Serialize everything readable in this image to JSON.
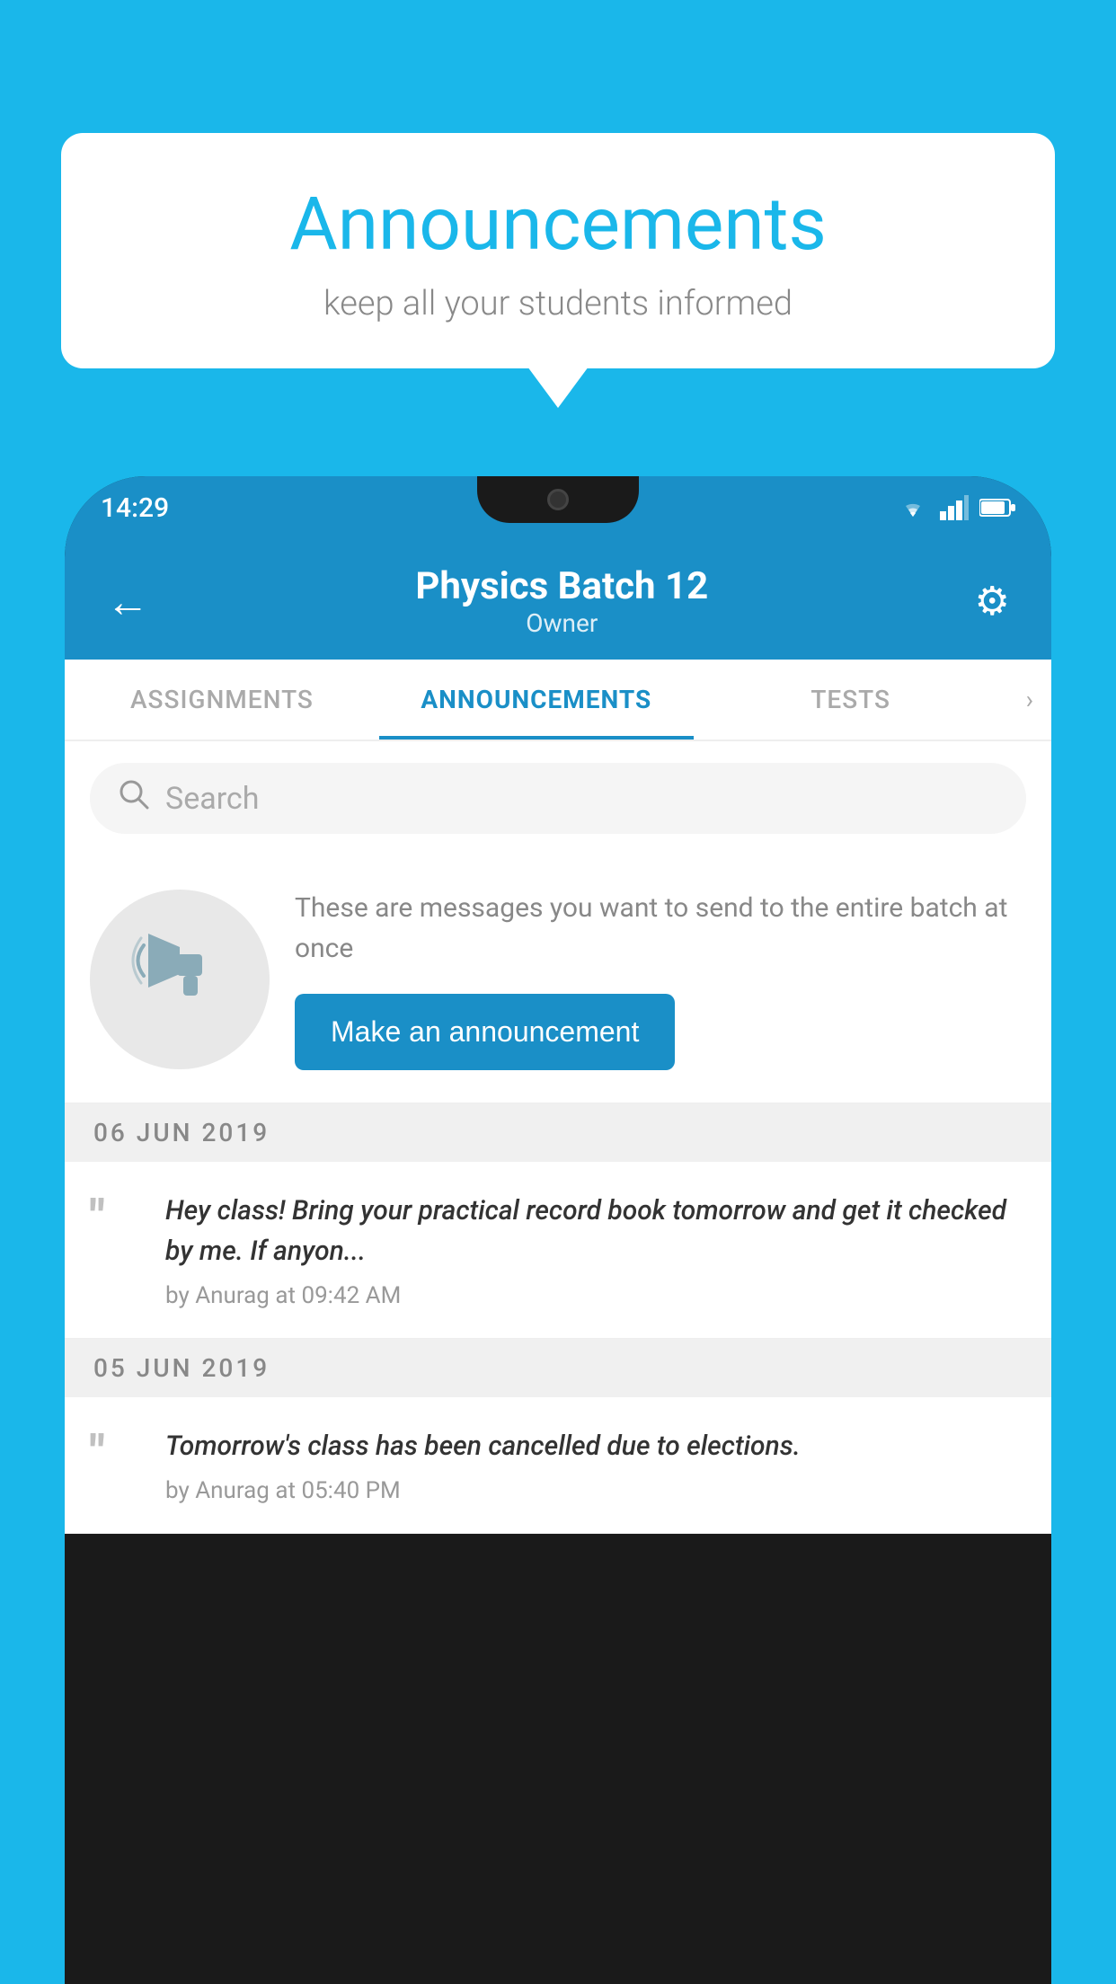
{
  "bubble": {
    "title": "Announcements",
    "subtitle": "keep all your students informed"
  },
  "status_bar": {
    "time": "14:29"
  },
  "header": {
    "title": "Physics Batch 12",
    "subtitle": "Owner",
    "back_label": "←",
    "gear_label": "⚙"
  },
  "tabs": [
    {
      "label": "ASSIGNMENTS",
      "active": false
    },
    {
      "label": "ANNOUNCEMENTS",
      "active": true
    },
    {
      "label": "TESTS",
      "active": false
    }
  ],
  "search": {
    "placeholder": "Search"
  },
  "intro": {
    "description": "These are messages you want to send to the entire batch at once",
    "button_label": "Make an announcement"
  },
  "announcements": [
    {
      "date": "06  JUN  2019",
      "items": [
        {
          "text": "Hey class! Bring your practical record book tomorrow and get it checked by me. If anyon...",
          "meta": "by Anurag at 09:42 AM"
        }
      ]
    },
    {
      "date": "05  JUN  2019",
      "items": [
        {
          "text": "Tomorrow's class has been cancelled due to elections.",
          "meta": "by Anurag at 05:40 PM"
        }
      ]
    }
  ],
  "colors": {
    "primary": "#1ab7ea",
    "header_bg": "#1a8fc7",
    "active_tab": "#1a8fc7",
    "button_bg": "#1a8fc7"
  }
}
